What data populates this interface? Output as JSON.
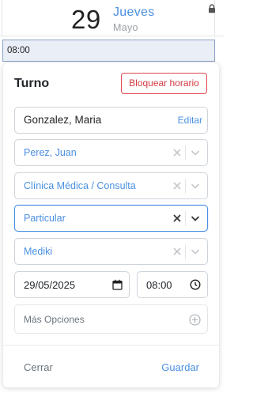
{
  "day_header": {
    "day_number": "29",
    "day_name": "Jueves",
    "month": "Mayo"
  },
  "time_slot": {
    "label": "08:00"
  },
  "turno": {
    "title": "Turno",
    "block_button_label": "Bloquear horario",
    "patient": {
      "value": "Gonzalez, Maria",
      "action_label": "Editar"
    },
    "professional": {
      "value": "Perez, Juan"
    },
    "specialty": {
      "value": "Clínica Médica / Consulta"
    },
    "coverage_type": {
      "value": "Particular"
    },
    "insurer": {
      "value": "Mediki"
    },
    "date": {
      "value": "29/05/2025"
    },
    "time": {
      "value": "08:00"
    },
    "more_options_label": "Más Opciones",
    "close_label": "Cerrar",
    "save_label": "Guardar"
  },
  "colors": {
    "accent": "#4a90e2",
    "danger": "#d33a40",
    "muted": "#6c757d"
  },
  "icons": {
    "lock": "lock-icon",
    "clear": "close-icon",
    "dropdown": "chevron-down-icon",
    "calendar": "calendar-icon",
    "clock": "clock-icon",
    "more": "plus-circle-icon"
  }
}
